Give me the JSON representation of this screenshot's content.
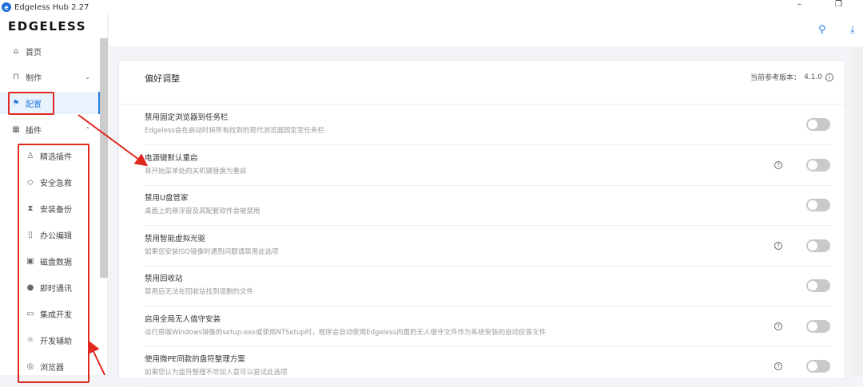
{
  "window": {
    "title": "Edgeless Hub 2.27",
    "minimize": "–",
    "restore": "❐"
  },
  "sidebar": {
    "brand": "EDGELESS",
    "items": [
      {
        "label": "首页",
        "icon": "home-icon"
      },
      {
        "label": "制作",
        "icon": "build-icon"
      },
      {
        "label": "配置",
        "icon": "flag-icon",
        "active": true
      },
      {
        "label": "插件",
        "icon": "grid-icon"
      }
    ],
    "plugins": [
      {
        "label": "精选插件",
        "icon": "trophy-icon"
      },
      {
        "label": "安全急救",
        "icon": "shield-icon"
      },
      {
        "label": "安装备份",
        "icon": "hourglass-icon"
      },
      {
        "label": "办公编辑",
        "icon": "document-icon"
      },
      {
        "label": "磁盘数据",
        "icon": "disk-icon"
      },
      {
        "label": "即时通讯",
        "icon": "chat-icon"
      },
      {
        "label": "集成开发",
        "icon": "terminal-icon"
      },
      {
        "label": "开发辅助",
        "icon": "bug-icon"
      },
      {
        "label": "浏览器",
        "icon": "browser-icon"
      }
    ]
  },
  "card": {
    "title": "偏好调整",
    "version_label": "当前参考版本：",
    "version": "4.1.0"
  },
  "settings": [
    {
      "title": "禁用固定浏览器到任务栏",
      "desc": "Edgeless会在启动时将所有找到的现代浏览器固定至任务栏",
      "help": false,
      "on": false
    },
    {
      "title": "电源键默认重启",
      "desc": "将开始菜单处的关机键替换为重启",
      "help": true,
      "on": false
    },
    {
      "title": "禁用U盘管家",
      "desc": "桌面上的悬浮窗及其配套软件会被禁用",
      "help": false,
      "on": false
    },
    {
      "title": "禁用智能虚拟光驱",
      "desc": "如果您安装ISO镜像时遇到问题请禁用此选项",
      "help": true,
      "on": false
    },
    {
      "title": "禁用回收站",
      "desc": "禁用后无法在回收站找到误删的文件",
      "help": false,
      "on": false
    },
    {
      "title": "启用全局无人值守安装",
      "desc": "运行原版Windows镜像的setup.exe或使用NTSetup时，程序会自动使用Edgeless内置的无人值守文件作为系统安装的自动应答文件",
      "help": true,
      "on": false
    },
    {
      "title": "使用微PE同款的盘符整理方案",
      "desc": "如果您认为盘符整理不尽如人意可以尝试此选项",
      "help": true,
      "on": false
    }
  ],
  "colors": {
    "accent": "#2b7de0",
    "annotation": "#e0281e"
  }
}
